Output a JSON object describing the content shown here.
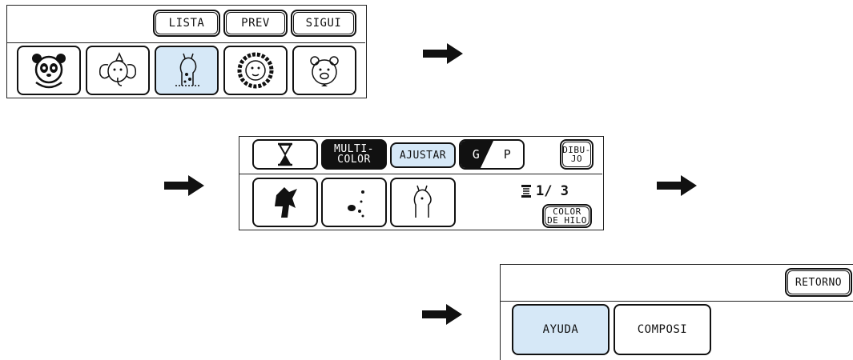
{
  "panel1": {
    "buttons": {
      "lista": "LISTA",
      "prev": "PREV",
      "sigui": "SIGUI"
    },
    "designs": [
      "panda-icon",
      "elephant-icon",
      "giraffe-icon",
      "lion-icon",
      "bear-icon"
    ],
    "selected_index": 2
  },
  "panel2": {
    "multi_line1": "MULTI-",
    "multi_line2": "COLOR",
    "ajustar": "AJUSTAR",
    "size_large": "G",
    "size_small": "P",
    "dibujo_line1": "DIBU-",
    "dibujo_line2": "JO",
    "thread_counter": "1/ 3",
    "color_hilo_line1": "COLOR",
    "color_hilo_line2": "DE HILO"
  },
  "panel3": {
    "retorno": "RETORNO",
    "ayuda": "AYUDA",
    "composi": "COMPOSI"
  },
  "colors": {
    "highlight": "#d6e8f7",
    "ink": "#111111"
  }
}
